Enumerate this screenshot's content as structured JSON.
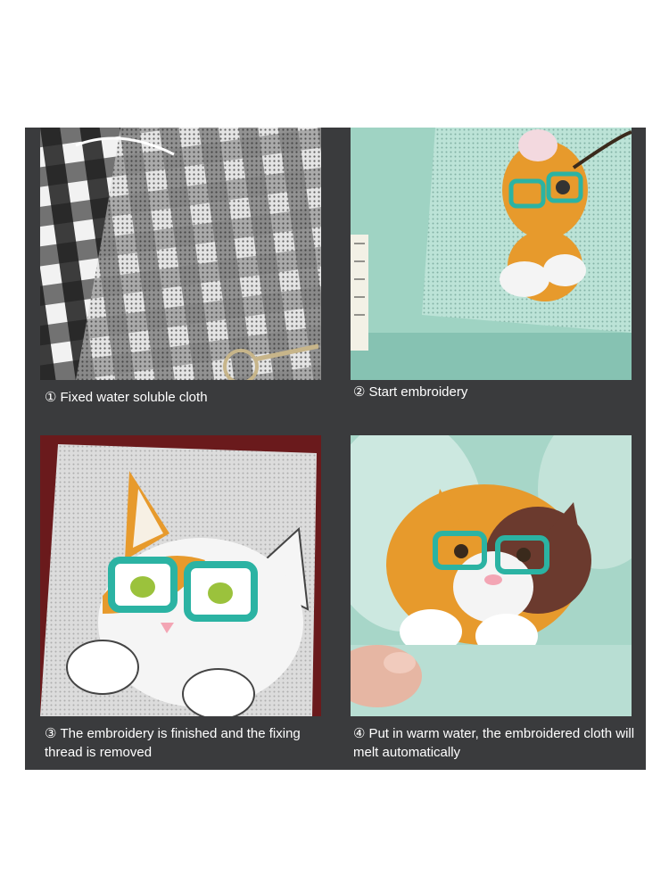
{
  "steps": [
    {
      "number": "①",
      "text": "Fixed water soluble cloth"
    },
    {
      "number": "②",
      "text": "Start embroidery"
    },
    {
      "number": "③",
      "text": "The embroidery is finished and the fixing thread is removed"
    },
    {
      "number": "④",
      "text": "Put in warm water, the embroidered cloth will melt automatically"
    }
  ],
  "colors": {
    "panel_background": "#3a3b3d",
    "caption_text": "#ffffff",
    "mint_fabric": "#9fd3c3",
    "plaid_dark": "#1e1e1e",
    "red_fabric": "#7a1f20",
    "glasses_teal": "#2bb3a3",
    "cat_orange": "#e79a2c"
  },
  "icons": [
    "scissors-icon",
    "measuring-tape-icon",
    "finger-icon"
  ]
}
